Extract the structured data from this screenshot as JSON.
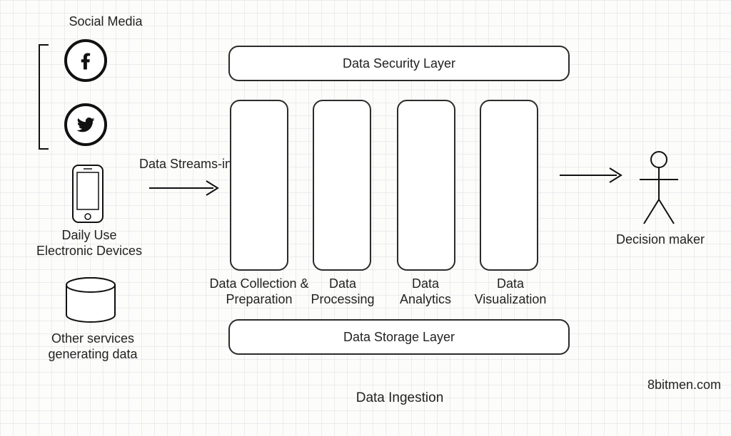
{
  "source_group": {
    "label": "Social Media",
    "daily_devices_label": "Daily Use\nElectronic Devices",
    "other_services_label": "Other services\ngenerating data"
  },
  "flow": {
    "streams_in_label": "Data Streams-in",
    "decision_maker_label": "Decision maker",
    "caption": "Data Ingestion"
  },
  "layers": {
    "top": "Data Security Layer",
    "bottom": "Data Storage Layer"
  },
  "pillars": [
    "Data Collection &\nPreparation",
    "Data\nProcessing",
    "Data\nAnalytics",
    "Data\nVisualization"
  ],
  "attribution": "8bitmen.com"
}
